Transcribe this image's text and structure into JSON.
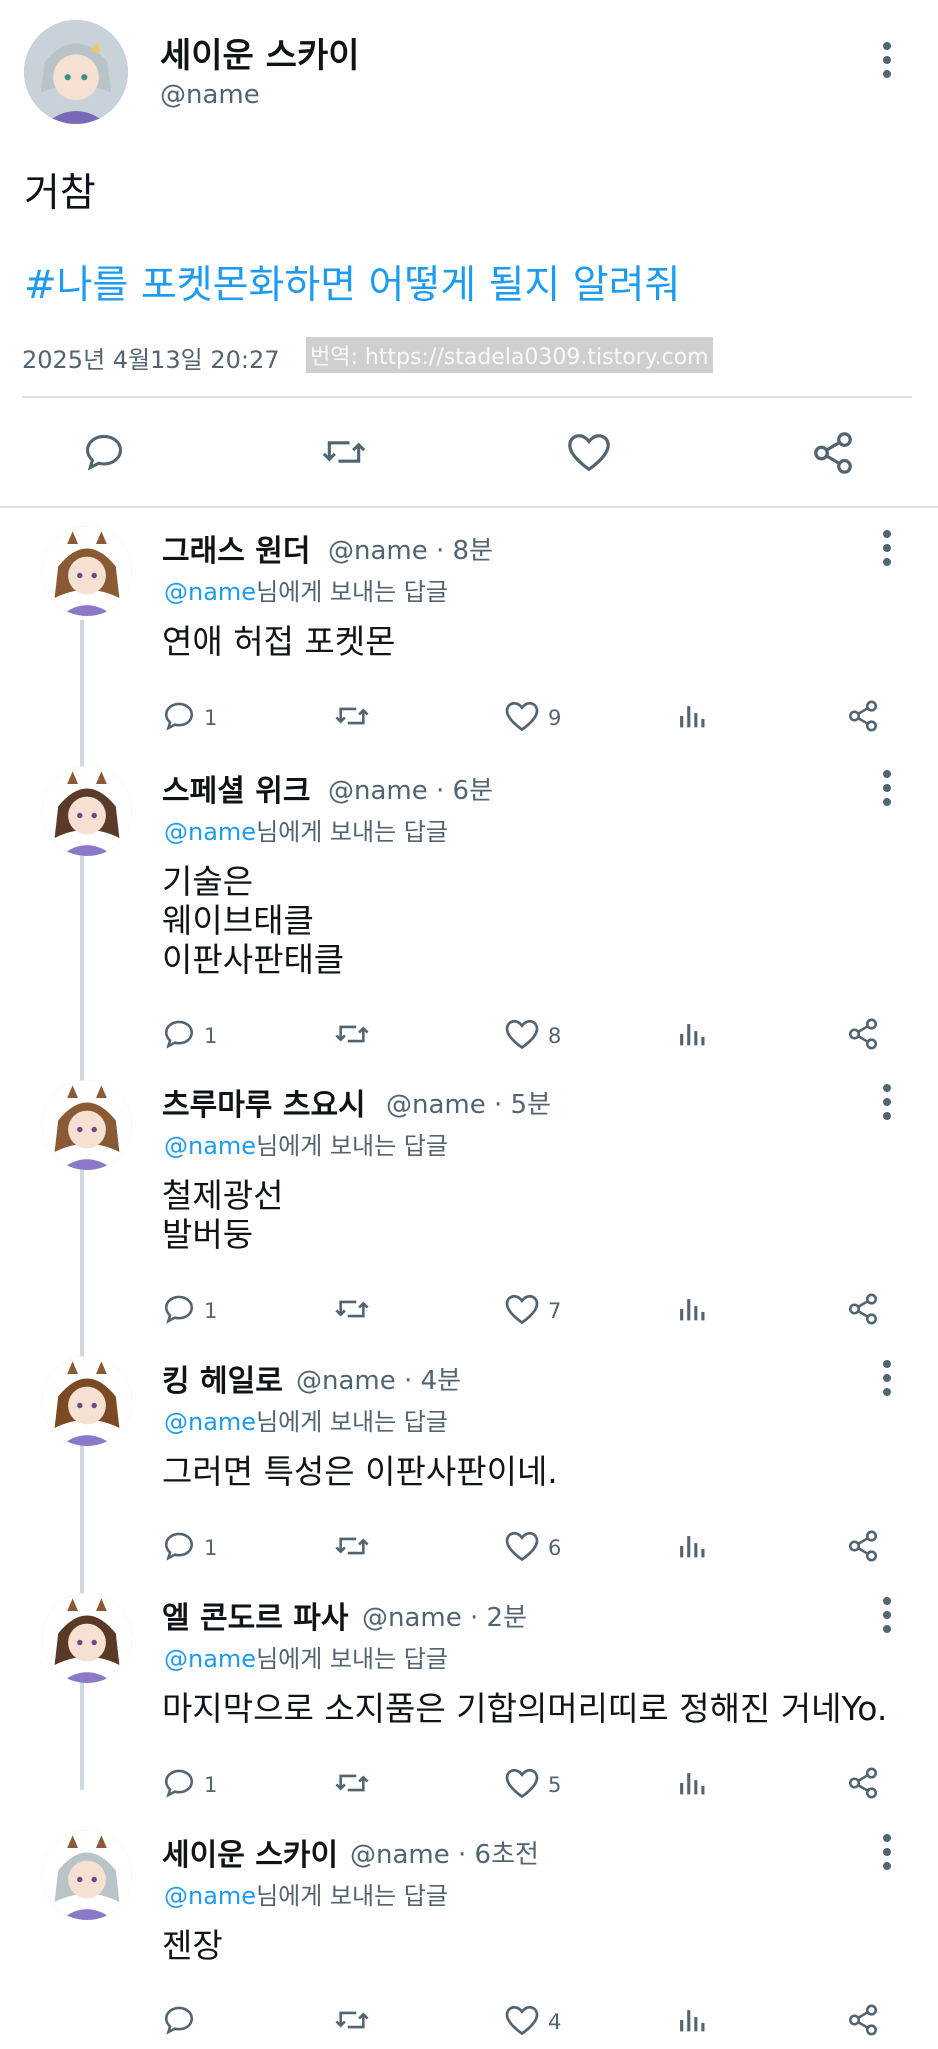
{
  "main_post": {
    "author_name": "세이운 스카이",
    "handle": "@name",
    "text": "거참",
    "hashtag": "#나를 포켓몬화하면 어떻게 될지 알려줘",
    "timestamp": "2025년 4월13일  20:27",
    "translate_link": "번역: https://stadela0309.tistory.com",
    "actions": [
      "reply-icon",
      "retweet-icon",
      "like-icon",
      "share-icon"
    ]
  },
  "reply_to_prefix_at": "@name",
  "reply_to_suffix": "님에게 보내는 답글",
  "replies": [
    {
      "name": "그래스 원더",
      "handle": "@name",
      "time": "· 8분",
      "lines": [
        "연애 허접 포켓몬"
      ],
      "replies": "1",
      "likes": "9"
    },
    {
      "name": "스페셜 위크",
      "handle": "@name",
      "time": "· 6분",
      "lines": [
        "기술은",
        "웨이브태클",
        "이판사판태클"
      ],
      "replies": "1",
      "likes": "8"
    },
    {
      "name": "츠루마루 츠요시",
      "handle": "@name",
      "time": "· 5분",
      "lines": [
        "철제광선",
        "발버둥"
      ],
      "replies": "1",
      "likes": "7"
    },
    {
      "name": "킹 헤일로",
      "handle": "@name",
      "time": "· 4분",
      "lines": [
        "그러면 특성은 이판사판이네."
      ],
      "replies": "1",
      "likes": "6"
    },
    {
      "name": "엘 콘도르 파사",
      "handle": "@name",
      "time": "· 2분",
      "lines": [
        "마지막으로 소지품은 기합의머리띠로 정해진 거네Yo."
      ],
      "replies": "1",
      "likes": "5"
    },
    {
      "name": "세이운 스카이",
      "handle": "@name",
      "time": "· 6초전",
      "lines": [
        "젠장"
      ],
      "replies": "",
      "likes": "4"
    }
  ],
  "colors": {
    "link": "#1d9bf0",
    "muted": "#536471",
    "text": "#0f1419",
    "divider": "#dfe3e6"
  }
}
